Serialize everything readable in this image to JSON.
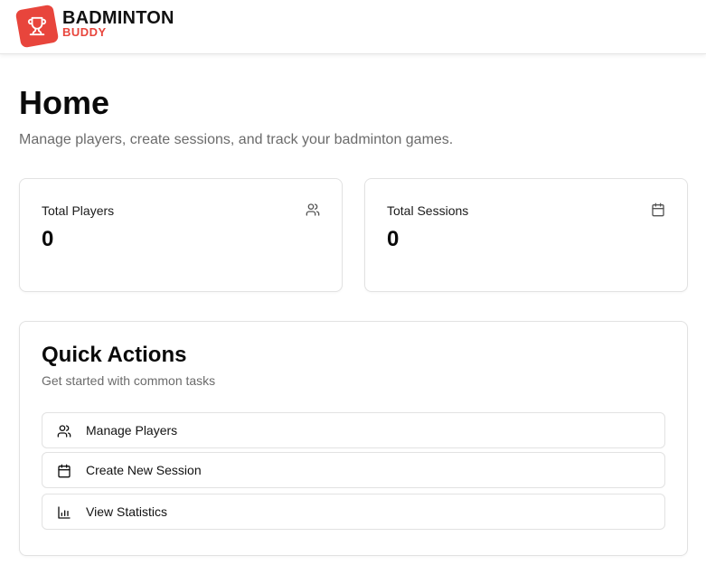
{
  "brand": {
    "name": "BADMINTON",
    "subname": "BUDDY",
    "logo_icon": "trophy-icon",
    "accent_color": "#e8453c"
  },
  "page": {
    "title": "Home",
    "subtitle": "Manage players, create sessions, and track your badminton games."
  },
  "stats": [
    {
      "label": "Total Players",
      "value": "0",
      "icon": "users-icon"
    },
    {
      "label": "Total Sessions",
      "value": "0",
      "icon": "calendar-icon"
    }
  ],
  "quick_actions": {
    "title": "Quick Actions",
    "description": "Get started with common tasks",
    "items": [
      {
        "label": "Manage Players",
        "icon": "users-icon"
      },
      {
        "label": "Create New Session",
        "icon": "calendar-icon"
      },
      {
        "label": "View Statistics",
        "icon": "bar-chart-icon"
      }
    ]
  }
}
